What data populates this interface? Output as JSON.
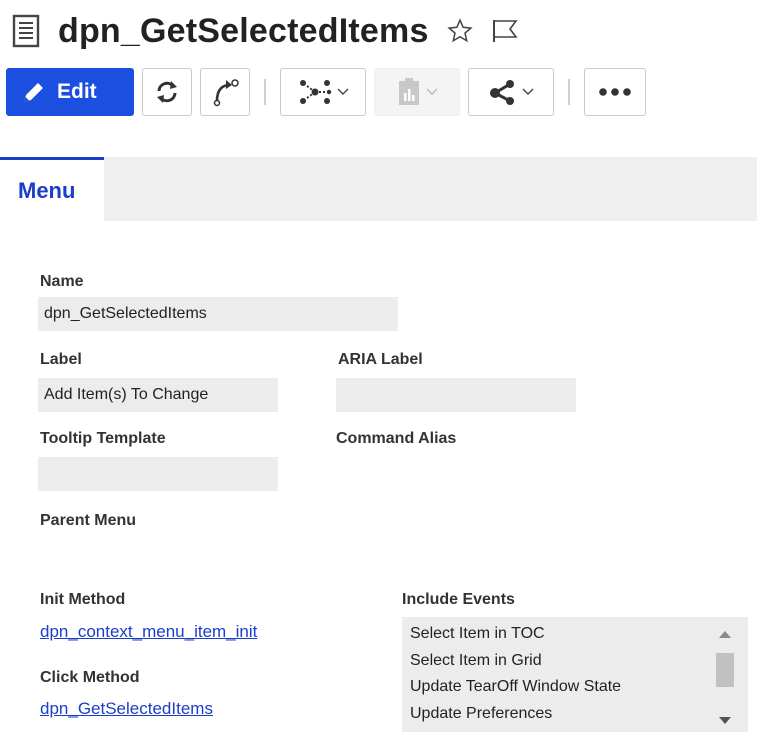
{
  "header": {
    "title": "dpn_GetSelectedItems",
    "icons": [
      "document-icon",
      "star-icon",
      "flag-icon"
    ]
  },
  "toolbar": {
    "edit_label": "Edit",
    "buttons": [
      "edit",
      "refresh",
      "claim",
      "structure-browser",
      "reports",
      "share",
      "more"
    ],
    "accent_color": "#1a4fe0"
  },
  "tabs": [
    {
      "label": "Menu",
      "active": true
    }
  ],
  "form": {
    "name_label": "Name",
    "name_value": "dpn_GetSelectedItems",
    "label_label": "Label",
    "label_value": "Add Item(s) To Change",
    "aria_label_label": "ARIA Label",
    "aria_label_value": "",
    "tooltip_label": "Tooltip Template",
    "tooltip_value": "",
    "command_alias_label": "Command Alias",
    "parent_menu_label": "Parent Menu",
    "init_method_label": "Init Method",
    "init_method_value": "dpn_context_menu_item_init",
    "click_method_label": "Click Method",
    "click_method_value": "dpn_GetSelectedItems",
    "include_events_label": "Include Events",
    "include_events": [
      "Select Item in TOC",
      "Select Item in Grid",
      "Update TearOff Window State",
      "Update Preferences"
    ]
  }
}
